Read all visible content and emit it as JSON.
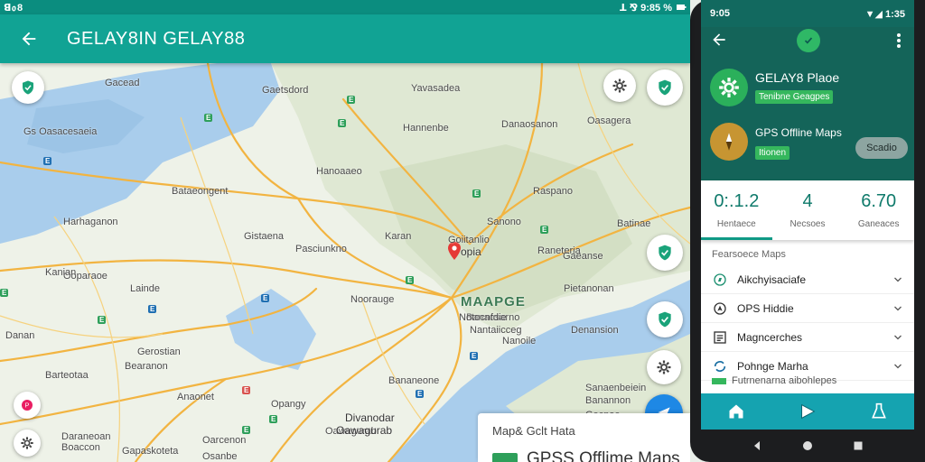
{
  "status_bar": {
    "left": "ꓭ᥆8",
    "right": "ꓕ ⅋ 9:85 %"
  },
  "app_bar": {
    "title": "GELAY8IN GELAY88"
  },
  "map": {
    "labels": [
      "Gacead",
      "Gaetsdord",
      "Yavasadea",
      "Oasagera",
      "Gs Oasacesaeia",
      "Hannenbe",
      "Danaosanon",
      "Hanoaaeo",
      "Bataeongent",
      "Raspano",
      "Sanono",
      "Harhaganon",
      "Gistaena",
      "Karan",
      "Batinae",
      "Pasciunkno",
      "Raneteria",
      "Gaeanse",
      "Ooparaoe",
      "Kanian",
      "Lainde",
      "Danan",
      "Noorauge",
      "Denansion",
      "Gerostian",
      "Bearanon",
      "Barteotaa",
      "Anaonet",
      "Bananeone",
      "Daraneoan",
      "Boaccon",
      "Oawagurab",
      "Gapaskoteta",
      "Osanbe",
      "Banaosarno",
      "Pietanonan",
      "Opangy",
      "Banannon",
      "Gecnoe",
      "Oarcenon",
      "Sanaenbeiein"
    ],
    "pin_label": "opia",
    "pin_sub": "Goiitanlio",
    "center_title": "MAAPGE",
    "center_sub1": "Notocnfdie",
    "center_sub2": "Nantaiicceg",
    "center_sub3": "Nanoile",
    "bottom_label1": "Divanodar",
    "bottom_label2": "Oawagurab"
  },
  "info_card": {
    "line1": "Map& Gclt Hata",
    "line2": "GPSS Offlime Maps"
  },
  "phone": {
    "status_time": "9:05",
    "status_right": "▼◢ 1:35",
    "app1": {
      "name": "GELAY8 Plaoe",
      "tag": "Tenibne Geagpes"
    },
    "app2": {
      "name": "GPS Offline Maps",
      "tag": "Itionen",
      "action": "Scadio"
    },
    "stats": [
      {
        "value": "0:.1.2",
        "label": "Hentaece"
      },
      {
        "value": "4",
        "label": "Necsoes"
      },
      {
        "value": "6.70",
        "label": "Ganeaces"
      }
    ],
    "section_title": "Fearsoece Maps",
    "list": [
      {
        "label": "Aikchyisaciafe",
        "icon": "compass-icon"
      },
      {
        "label": "OPS Hiddie",
        "icon": "navigation-icon"
      },
      {
        "label": "Magncerches",
        "icon": "list-icon"
      },
      {
        "label": "Pohnge Marha",
        "icon": "sync-icon"
      }
    ],
    "sub_text": "Futrnenarna aibohlepes"
  },
  "colors": {
    "accent": "#11a394",
    "dark": "#146459",
    "green": "#35b75d",
    "blue": "#1e88e5"
  }
}
